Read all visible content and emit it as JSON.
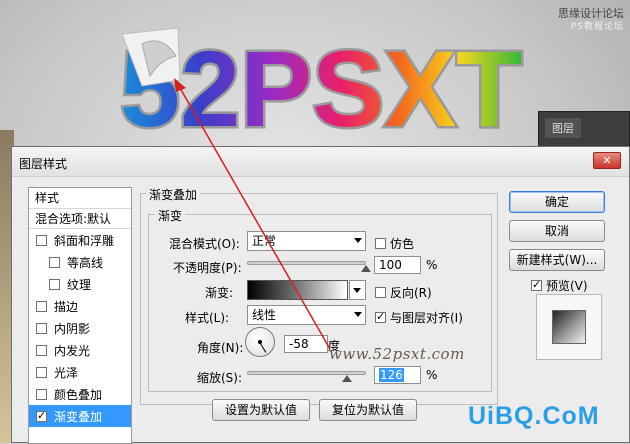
{
  "background": {
    "site_text": "思缘设计论坛",
    "site_text_sub": "PS教程论坛",
    "art_word": "52PSXT",
    "layers_panel_tab": "图层"
  },
  "dialog": {
    "title": "图层样式",
    "close_icon": "close-icon",
    "style_list": {
      "header": "样式",
      "blend_options": "混合选项:默认",
      "items": [
        {
          "label": "斜面和浮雕",
          "checked": false,
          "indent": false,
          "selected": false
        },
        {
          "label": "等高线",
          "checked": false,
          "indent": true,
          "selected": false
        },
        {
          "label": "纹理",
          "checked": false,
          "indent": true,
          "selected": false
        },
        {
          "label": "描边",
          "checked": false,
          "indent": false,
          "selected": false
        },
        {
          "label": "内阴影",
          "checked": false,
          "indent": false,
          "selected": false
        },
        {
          "label": "内发光",
          "checked": false,
          "indent": false,
          "selected": false
        },
        {
          "label": "光泽",
          "checked": false,
          "indent": false,
          "selected": false
        },
        {
          "label": "颜色叠加",
          "checked": false,
          "indent": false,
          "selected": false
        },
        {
          "label": "渐变叠加",
          "checked": true,
          "indent": false,
          "selected": true
        }
      ]
    },
    "gradient_overlay": {
      "group_title": "渐变叠加",
      "subgroup_title": "渐变",
      "blend_mode_label": "混合模式(O):",
      "blend_mode_value": "正常",
      "dither_label": "仿色",
      "dither_checked": false,
      "opacity_label": "不透明度(P):",
      "opacity_value": "100",
      "opacity_unit": "%",
      "opacity_fraction": 1.0,
      "gradient_label": "渐变:",
      "reverse_label": "反向(R)",
      "reverse_checked": false,
      "style_label": "样式(L):",
      "style_value": "线性",
      "align_label": "与图层对齐(I)",
      "align_checked": true,
      "angle_label": "角度(N):",
      "angle_value": "-58",
      "angle_unit": "度",
      "scale_label": "缩放(S):",
      "scale_value": "126",
      "scale_unit": "%",
      "scale_fraction": 0.84,
      "set_default_button": "设置为默认值",
      "reset_default_button": "复位为默认值"
    },
    "buttons": {
      "ok": "确定",
      "cancel": "取消",
      "new_style": "新建样式(W)...",
      "preview_label": "预览(V)",
      "preview_checked": true
    }
  },
  "overlay": {
    "watermark": "www.52psxt.com",
    "brand_logo": "UiBQ.CoM",
    "arrow_color": "#d42020"
  }
}
